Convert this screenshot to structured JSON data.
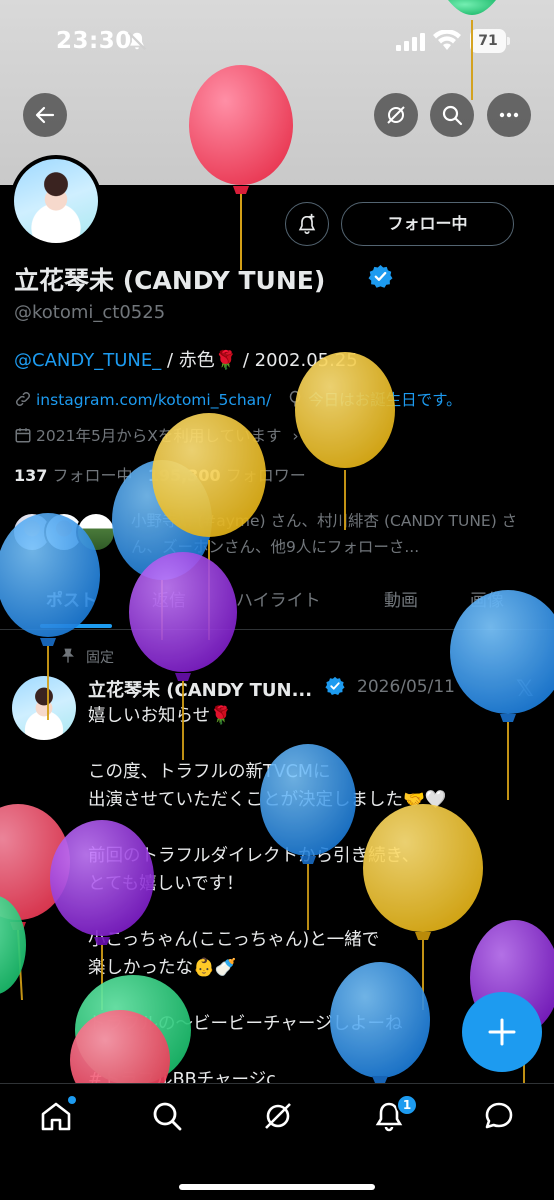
{
  "status_bar": {
    "time": "23:30",
    "battery": "71"
  },
  "profile": {
    "display_name": "立花琴未 (CANDY TUNE)",
    "handle": "@kotomi_ct0525",
    "follow_button": "フォロー中",
    "bio_mention": "@CANDY_TUNE_",
    "bio_rest": " / 赤色🌹 / 2002.05.25",
    "website": "instagram.com/kotomi_5chan/",
    "birthday": "今日はお誕生日です。",
    "joined": "2021年5月からXを利用しています",
    "following_count": "137",
    "following_label": "フォロー中",
    "followers_count": "195,300",
    "followers_label": "フォロワー",
    "followers_you_know": "小野寺... (#ayme) さん、村川緋杏 (CANDY TUNE) さん、ズーホンさん、他9人にフォローさ..."
  },
  "tabs": [
    {
      "label": "ポスト"
    },
    {
      "label": "返信"
    },
    {
      "label": "ハイライト"
    },
    {
      "label": "動画"
    },
    {
      "label": "画像"
    }
  ],
  "post": {
    "pinned_label": "固定",
    "author": "立花琴未 (CANDY TUN...",
    "date": "2026/05/11",
    "text": "嬉しいお知らせ🌹\n\nこの度、トラフルの新TVCMに\n出演させていただくことが決定しました🤝🤍\n\n前回のトラフルダイレクトから引き続き、\nとても嬉しいです！\n\n小こっちゃん(ここっちゃん)と一緒で\n楽しかったな👶🍼\n\nトラフルの〜ビービーチャージしよーね\n\n#トラフルBBチャージc"
  },
  "nav": {
    "notification_badge": "1"
  },
  "colors": {
    "accent": "#1d9bf0",
    "background": "#000000",
    "text": "#e7e9ea",
    "muted": "#71767b"
  }
}
